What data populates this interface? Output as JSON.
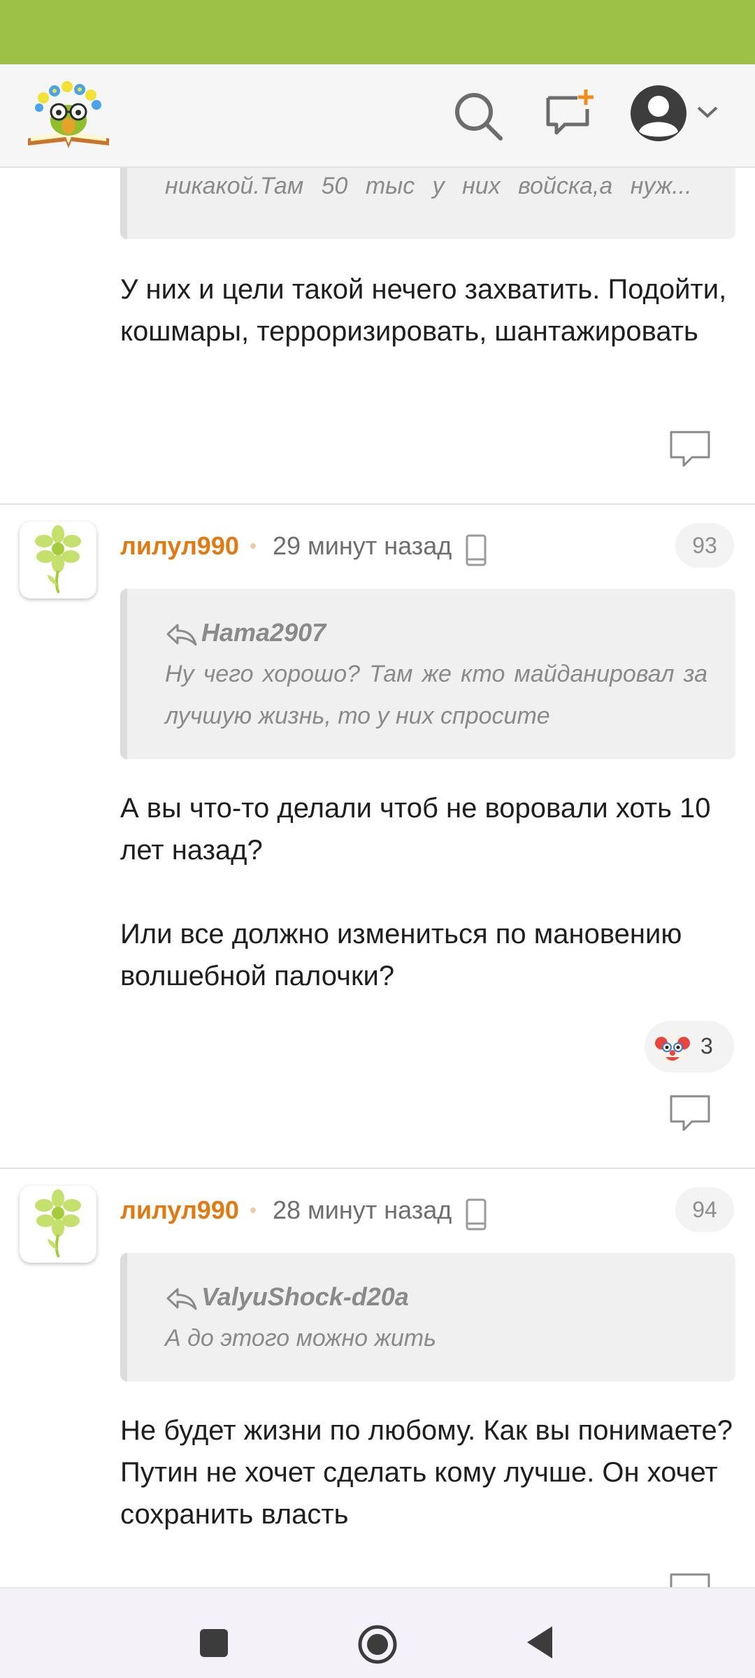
{
  "header": {
    "logo_icon": "owl-book-logo-icon",
    "search_icon": "search-icon",
    "compose_icon": "new-message-icon",
    "profile_icon": "account-icon",
    "menu_icon": "chevron-down-icon"
  },
  "colors": {
    "status_bar": "#9dc147",
    "username": "#e07a12",
    "quote_bg": "#f0f0f0",
    "text": "#1e1e1e"
  },
  "comments": [
    {
      "quote_text": "никакой.Там 50 тыс у них войска,а нуж...",
      "text": "У них и цели такой нечего захватить. Подойти, кошмары, терроризировать, шантажировать"
    },
    {
      "username": "лилул990",
      "time": "29 минут назад",
      "number": "93",
      "quote_author": "Ната2907",
      "quote_text": "Ну чего хорошо? Там же кто майданировал за лучшую жизнь, то у них спросите",
      "text_p1": "А вы что-то делали чтоб не воровали хоть 10 лет назад?",
      "text_p2": "Или все должно измениться по мановению волшебной палочки?",
      "reaction_icon": "clown-emoji-icon",
      "reaction_count": "3"
    },
    {
      "username": "лилул990",
      "time": "28 минут назад",
      "number": "94",
      "quote_author": "ValyuShock-d20a",
      "quote_text": "А до этого можно жить",
      "text": "Не будет жизни по любому. Как вы понимаете? Путин не хочет сделать кому лучше. Он хочет сохранить власть"
    }
  ],
  "navbar": {
    "recents_icon": "recents-square-icon",
    "home_icon": "home-circle-icon",
    "back_icon": "back-triangle-icon"
  }
}
